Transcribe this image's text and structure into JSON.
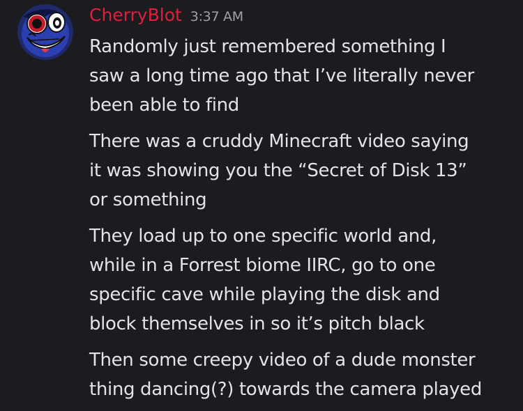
{
  "message": {
    "author": "CherryBlot",
    "timestamp": "3:37 AM",
    "avatar_icon": "cartoon-face-avatar-icon",
    "author_color": "#e01f3d",
    "paragraphs": [
      {
        "lines": [
          "Randomly just remembered something I",
          "saw a long time ago that I’ve literally never",
          "been able to find"
        ]
      },
      {
        "lines": [
          "There was a cruddy Minecraft video saying",
          "it was showing you the “Secret of Disk 13”",
          "or something"
        ]
      },
      {
        "lines": [
          "They load up to one specific world and,",
          "while in a Forrest biome IIRC, go to one",
          "specific cave while playing the disk and",
          "block themselves in so it’s pitch black"
        ]
      },
      {
        "lines": [
          "Then some creepy video of a dude monster",
          "thing dancing(?) towards the camera played"
        ]
      }
    ]
  }
}
